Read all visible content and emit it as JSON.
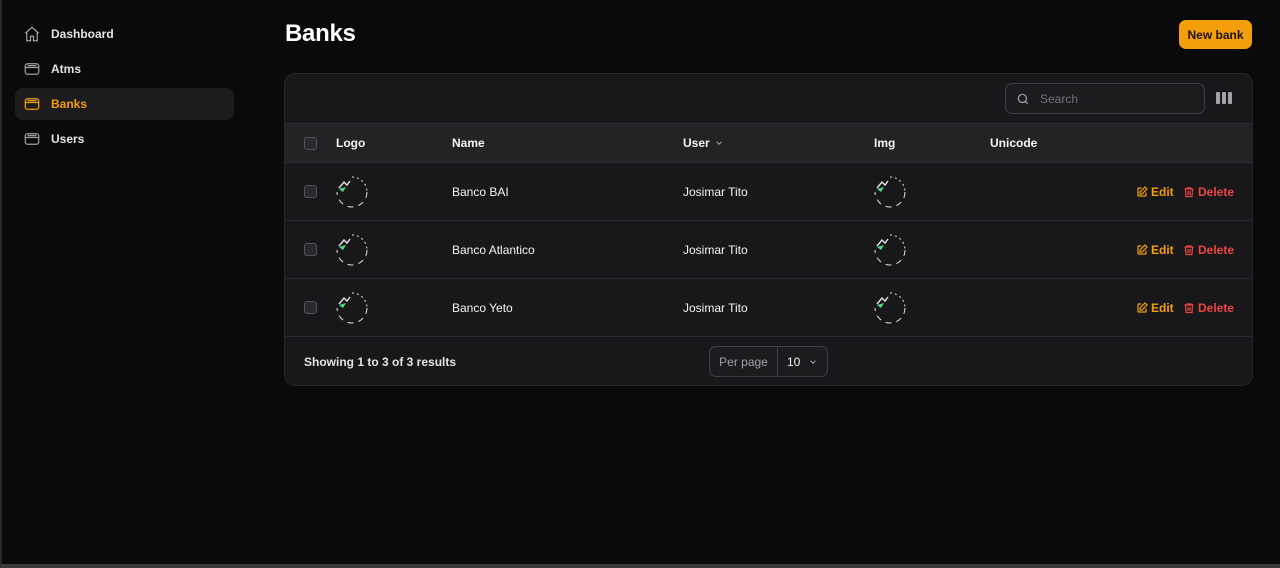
{
  "sidebar": {
    "items": [
      {
        "label": "Dashboard",
        "icon": "home-icon",
        "active": false
      },
      {
        "label": "Atms",
        "icon": "archive-icon",
        "active": false
      },
      {
        "label": "Banks",
        "icon": "archive-icon",
        "active": true
      },
      {
        "label": "Users",
        "icon": "archive-icon",
        "active": false
      }
    ]
  },
  "header": {
    "title": "Banks",
    "new_button_label": "New bank"
  },
  "toolbar": {
    "search_placeholder": "Search",
    "search_value": ""
  },
  "table": {
    "columns": [
      "Logo",
      "Name",
      "User",
      "Img",
      "Unicode"
    ],
    "rows": [
      {
        "name": "Banco BAI",
        "user": "Josimar Tito",
        "unicode": "",
        "edit": "Edit",
        "delete": "Delete"
      },
      {
        "name": "Banco Atlantico",
        "user": "Josimar Tito",
        "unicode": "",
        "edit": "Edit",
        "delete": "Delete"
      },
      {
        "name": "Banco Yeto",
        "user": "Josimar Tito",
        "unicode": "",
        "edit": "Edit",
        "delete": "Delete"
      }
    ]
  },
  "footer": {
    "showing": "Showing 1 to 3 of 3 results",
    "per_page_label": "Per page",
    "per_page_value": "10"
  },
  "colors": {
    "accent": "#f59e0b",
    "danger": "#ef4444",
    "background": "#0a0a0b",
    "card": "#18181b"
  }
}
